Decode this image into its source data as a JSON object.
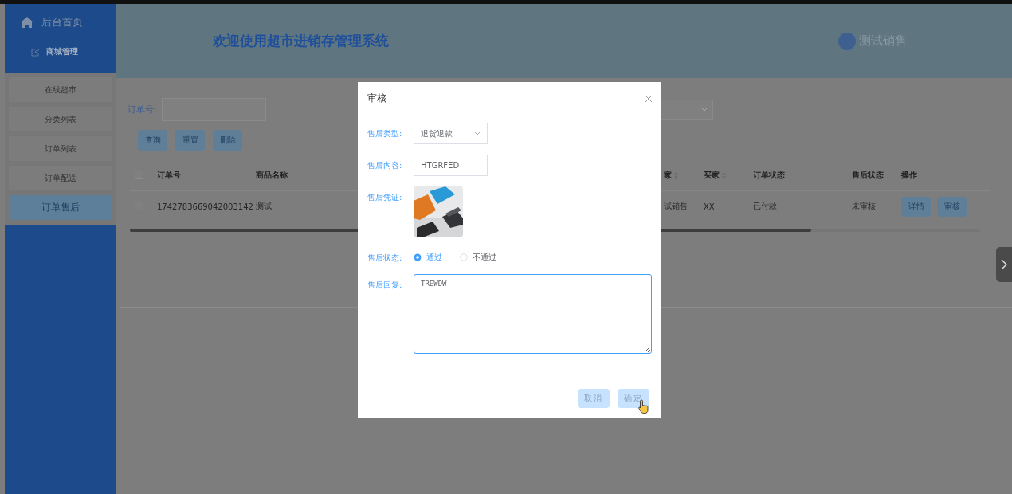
{
  "sidebar": {
    "home": "后台首页",
    "section": "商城管理",
    "items": [
      {
        "label": "在线超市",
        "selected": false
      },
      {
        "label": "分类列表",
        "selected": false
      },
      {
        "label": "订单列表",
        "selected": false
      },
      {
        "label": "订单配送",
        "selected": false
      },
      {
        "label": "订单售后",
        "selected": true
      }
    ]
  },
  "header": {
    "title": "欢迎使用超市进销存管理系统",
    "user": "测试销售"
  },
  "filters": {
    "order_no_label": "订单号:"
  },
  "buttons": [
    "查询",
    "重置",
    "删除"
  ],
  "table": {
    "select_all_checked": false,
    "columns": [
      {
        "label": "订单号",
        "sortable": false
      },
      {
        "label": "商品名称",
        "sortable": false
      },
      {
        "label": "家",
        "sortable": true
      },
      {
        "label": "买家",
        "sortable": true
      },
      {
        "label": "订单状态",
        "sortable": false
      },
      {
        "label": "售后状态",
        "sortable": false
      },
      {
        "label": "操作",
        "sortable": false
      }
    ],
    "rows": [
      {
        "checked": false,
        "cells": [
          "1742783669042003142",
          "测试",
          "试销售",
          "XX",
          "已付款",
          "未审核"
        ],
        "actions": [
          "详情",
          "审核"
        ]
      }
    ]
  },
  "dialog": {
    "title": "审核",
    "fields": [
      {
        "kind": "select",
        "label": "售后类型:",
        "value": "退货退款"
      },
      {
        "kind": "input",
        "label": "售后内容:",
        "value": "HTGRFED"
      },
      {
        "kind": "picture",
        "label": "售后凭证:"
      },
      {
        "kind": "radio",
        "label": "售后状态:",
        "options": [
          {
            "label": "通过",
            "selected": true
          },
          {
            "label": "不通过",
            "selected": false
          }
        ]
      },
      {
        "kind": "textarea",
        "label": "售后回复:",
        "value": "TREWDW"
      }
    ],
    "buttons": [
      "取消",
      "确定"
    ]
  }
}
